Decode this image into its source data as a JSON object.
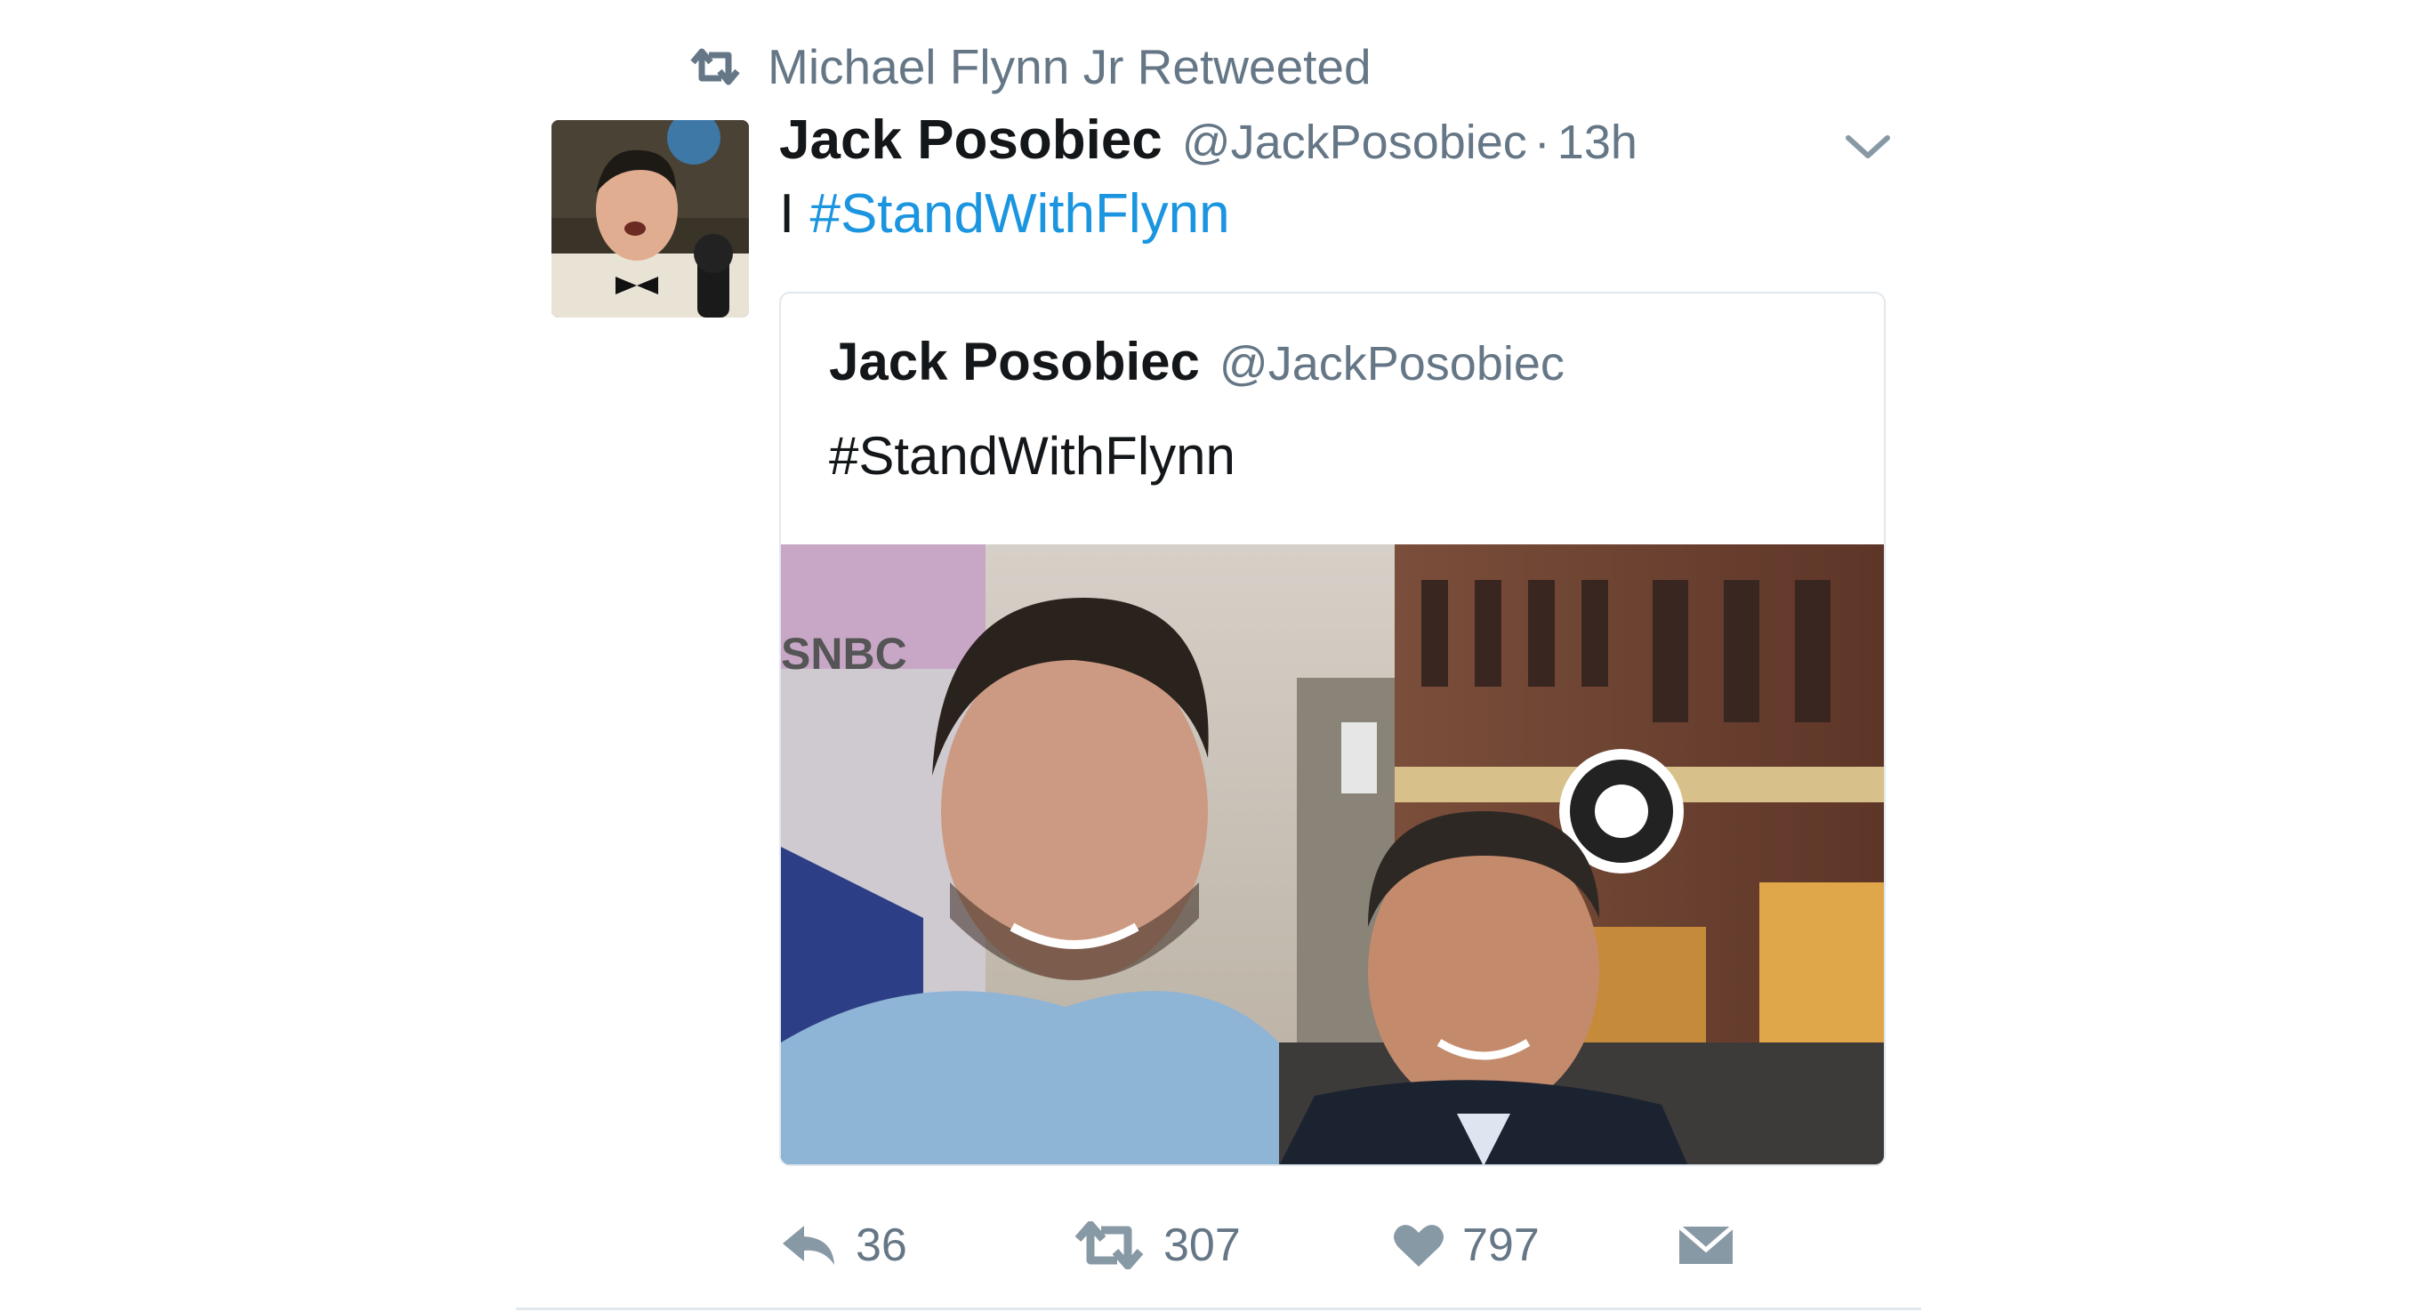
{
  "retweet_context": {
    "text": "Michael Flynn Jr Retweeted",
    "icon": "retweet-icon"
  },
  "tweet": {
    "author_name": "Jack Posobiec",
    "author_handle": "@JackPosobiec",
    "separator": "·",
    "time": "13h",
    "text_prefix": "I",
    "hashtag": "#StandWithFlynn",
    "menu_icon": "chevron-down-icon"
  },
  "quoted_tweet": {
    "author_name": "Jack Posobiec",
    "author_handle": "@JackPosobiec",
    "text": "#StandWithFlynn",
    "photo_sign_text": "SNBC"
  },
  "actions": {
    "reply_count": "36",
    "retweet_count": "307",
    "like_count": "797",
    "icons": [
      "reply-icon",
      "retweet-icon",
      "heart-icon",
      "direct-message-icon"
    ]
  },
  "colors": {
    "link": "#1b95e0",
    "secondary_text": "#657786",
    "primary_text": "#14171a",
    "border": "#e1e8ed"
  }
}
